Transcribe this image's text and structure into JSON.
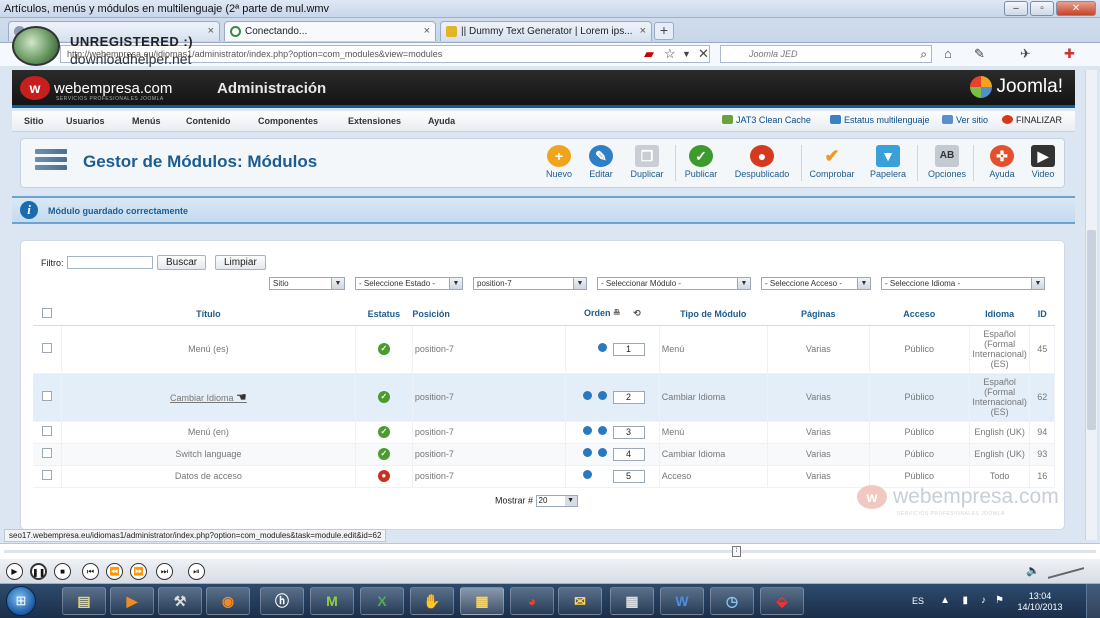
{
  "window": {
    "title": "Artículos, menús y módulos en multilenguaje (2ª parte de mul.wmv"
  },
  "tabs": [
    {
      "label": ""
    },
    {
      "label": "Conectando..."
    },
    {
      "label": "|| Dummy Text Generator | Lorem ips..."
    }
  ],
  "address": {
    "url": "http://webempresa.eu/idiomas1/administrator/index.php?option=com_modules&view=modules"
  },
  "search": {
    "placeholder": "Joomla JED"
  },
  "watermark": {
    "line1": "UNREGISTERED :)",
    "line2": "downloadhelper.net"
  },
  "header": {
    "brand": "webempresa.com",
    "brand_sub": "SERVICIOS PROFESIONALES JOOMLA",
    "admin": "Administración",
    "joomla": "Joomla!"
  },
  "menu": {
    "items": [
      "Sitio",
      "Usuarios",
      "Menús",
      "Contenido",
      "Componentes",
      "Extensiones",
      "Ayuda"
    ],
    "right": [
      "JAT3 Clean Cache",
      "Estatus multilenguaje",
      "Ver sitio",
      "FINALIZAR"
    ]
  },
  "toolbar": {
    "title": "Gestor de Módulos: Módulos",
    "buttons": [
      "Nuevo",
      "Editar",
      "Duplicar",
      "Publicar",
      "Despublicado",
      "Comprobar",
      "Papelera",
      "Opciones",
      "Ayuda",
      "Video"
    ]
  },
  "message": {
    "text": "Módulo guardado correctamente"
  },
  "filters": {
    "label": "Filtro:",
    "search_value": "",
    "buscar": "Buscar",
    "limpiar": "Limpiar",
    "selects": [
      "Sitio",
      "- Seleccione Estado -",
      "position-7",
      "- Seleccionar Módulo -",
      "- Seleccione Acceso -",
      "- Seleccione Idioma -"
    ]
  },
  "table": {
    "headers": {
      "title": "Título",
      "status": "Estatus",
      "position": "Posición",
      "order": "Orden",
      "type": "Tipo de Módulo",
      "pages": "Páginas",
      "access": "Acceso",
      "language": "Idioma",
      "id": "ID"
    },
    "rows": [
      {
        "title": "Menú (es)",
        "status": "ok",
        "position": "position-7",
        "order": "1",
        "type": "Menú",
        "pages": "Varias",
        "access": "Público",
        "language": "Español (Formal Internacional) (ES)",
        "id": "45"
      },
      {
        "title": "Cambiar Idioma",
        "status": "ok",
        "position": "position-7",
        "order": "2",
        "type": "Cambiar Idioma",
        "pages": "Varias",
        "access": "Público",
        "language": "Español (Formal Internacional) (ES)",
        "id": "62"
      },
      {
        "title": "Menú (en)",
        "status": "ok",
        "position": "position-7",
        "order": "3",
        "type": "Menú",
        "pages": "Varias",
        "access": "Público",
        "language": "English (UK)",
        "id": "94"
      },
      {
        "title": "Switch language",
        "status": "ok",
        "position": "position-7",
        "order": "4",
        "type": "Cambiar Idioma",
        "pages": "Varias",
        "access": "Público",
        "language": "English (UK)",
        "id": "93"
      },
      {
        "title": "Datos de acceso",
        "status": "no",
        "position": "position-7",
        "order": "5",
        "type": "Acceso",
        "pages": "Varias",
        "access": "Público",
        "language": "Todo",
        "id": "16"
      }
    ]
  },
  "pagination": {
    "label": "Mostrar #",
    "value": "20"
  },
  "footer_brand": {
    "name": "webempresa.com",
    "sub": "SERVICIOS PROFESIONALES JOOMLA"
  },
  "status_url": "seo17.webempresa.eu/idiomas1/administrator/index.php?option=com_modules&task=module.edit&id=62",
  "taskbar": {
    "lang": "ES",
    "time": "13:04",
    "date": "14/10/2013"
  }
}
